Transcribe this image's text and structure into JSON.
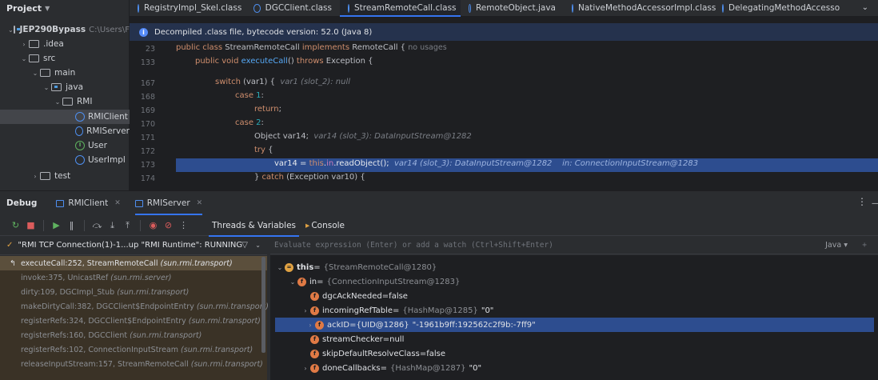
{
  "project_panel": {
    "title": "Project",
    "tree": [
      {
        "label": "JEP290Bypass",
        "hint": "C:\\Users\\F"
      },
      {
        "label": ".idea"
      },
      {
        "label": "src"
      },
      {
        "label": "main"
      },
      {
        "label": "java"
      },
      {
        "label": "RMI"
      },
      {
        "label": "RMIClient"
      },
      {
        "label": "RMIServer"
      },
      {
        "label": "User"
      },
      {
        "label": "UserImpl"
      },
      {
        "label": "test"
      }
    ]
  },
  "editor_tabs": [
    {
      "label": "RegistryImpl_Skel.class"
    },
    {
      "label": "DGCClient.class"
    },
    {
      "label": "StreamRemoteCall.class"
    },
    {
      "label": "RemoteObject.java"
    },
    {
      "label": "NativeMethodAccessorImpl.class"
    },
    {
      "label": "DelegatingMethodAccesso"
    }
  ],
  "banner": {
    "text": "Decompiled .class file, bytecode version: 52.0 (Java 8)"
  },
  "code_lines": [
    {
      "n": "23",
      "p1": "public class ",
      "p2": "StreamRemoteCall ",
      "p3": "implements ",
      "p4": "RemoteCall {",
      "hint": "no usages"
    },
    {
      "n": "133",
      "p1": "public void ",
      "p2": "executeCall",
      "p3": "() ",
      "p4": "throws ",
      "p5": "Exception {"
    },
    {
      "n": "167",
      "p1": "switch ",
      "p2": "(var1) {",
      "hint": "var1 (slot_2): null"
    },
    {
      "n": "168",
      "p1": "case ",
      "p2": "1",
      "p3": ":"
    },
    {
      "n": "169",
      "p1": "return",
      "p2": ";"
    },
    {
      "n": "170",
      "p1": "case ",
      "p2": "2",
      "p3": ":"
    },
    {
      "n": "171",
      "p1": "Object var14;",
      "hint": "var14 (slot_3): DataInputStream@1282"
    },
    {
      "n": "172",
      "p1": "try ",
      "p2": "{"
    },
    {
      "n": "173",
      "p1": "var14 = ",
      "p2": "this",
      "p3": ".",
      "p4": "in",
      "p5": ".readObject();",
      "hint": "var14 (slot_3): DataInputStream@1282",
      "hint2": "in: ConnectionInputStream@1283"
    },
    {
      "n": "174",
      "p1": "} ",
      "p2": "catch ",
      "p3": "(Exception var10) {"
    }
  ],
  "debug": {
    "title": "Debug",
    "tabs": [
      {
        "label": "RMIClient"
      },
      {
        "label": "RMIServer"
      }
    ],
    "subtabs": [
      {
        "label": "Threads & Variables"
      },
      {
        "label": "Console"
      }
    ],
    "thread": "\"RMI TCP Connection(1)-1...up \"RMI Runtime\": RUNNING",
    "frames": [
      {
        "method": "executeCall:252, StreamRemoteCall",
        "pkg": "(sun.rmi.transport)"
      },
      {
        "method": "invoke:375, UnicastRef",
        "pkg": "(sun.rmi.server)"
      },
      {
        "method": "dirty:109, DGCImpl_Stub",
        "pkg": "(sun.rmi.transport)"
      },
      {
        "method": "makeDirtyCall:382, DGCClient$EndpointEntry",
        "pkg": "(sun.rmi.transport)"
      },
      {
        "method": "registerRefs:324, DGCClient$EndpointEntry",
        "pkg": "(sun.rmi.transport)"
      },
      {
        "method": "registerRefs:160, DGCClient",
        "pkg": "(sun.rmi.transport)"
      },
      {
        "method": "registerRefs:102, ConnectionInputStream",
        "pkg": "(sun.rmi.transport)"
      },
      {
        "method": "releaseInputStream:157, StreamRemoteCall",
        "pkg": "(sun.rmi.transport)"
      }
    ],
    "eval_placeholder": "Evaluate expression (Enter) or add a watch (Ctrl+Shift+Enter)",
    "lang": "Java",
    "variables": [
      {
        "name": "this",
        "eq": " = ",
        "type": "{StreamRemoteCall@1280}",
        "val": ""
      },
      {
        "name": "in",
        "eq": " = ",
        "type": "{ConnectionInputStream@1283}",
        "val": ""
      },
      {
        "name": "dgcAckNeeded",
        "eq": " = ",
        "type": "",
        "val": "false"
      },
      {
        "name": "incomingRefTable",
        "eq": " = ",
        "type": "{HashMap@1285}",
        "val": "\"0\""
      },
      {
        "name": "ackID",
        "eq": " = ",
        "type": "{UID@1286}",
        "val": "\"-1961b9ff:192562c2f9b:-7ff9\""
      },
      {
        "name": "streamChecker",
        "eq": " = ",
        "type": "",
        "val": "null"
      },
      {
        "name": "skipDefaultResolveClass",
        "eq": " = ",
        "type": "",
        "val": "false"
      },
      {
        "name": "doneCallbacks",
        "eq": " = ",
        "type": "{HashMap@1287}",
        "val": "\"0\""
      }
    ]
  },
  "colors": {
    "accent": "#3574f0",
    "selection": "#2d4d8f",
    "frame_bg": "#3a3226"
  }
}
